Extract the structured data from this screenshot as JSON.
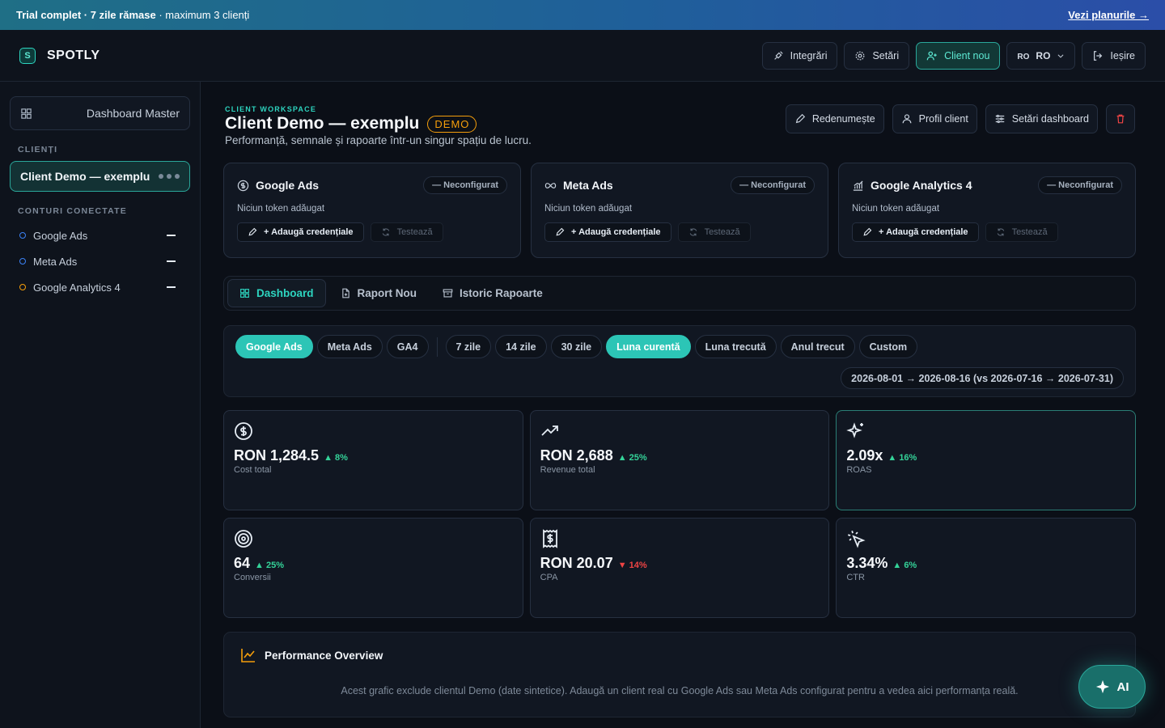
{
  "banner": {
    "text_bold": "Trial complet · 7 zile rămase",
    "text_rest": " · maximum 3 clienți",
    "link": "Vezi planurile →"
  },
  "header": {
    "logo_mark": "S",
    "app_name": "SPOTLY",
    "integrations": "Integrări",
    "settings": "Setări",
    "new_client": "Client nou",
    "lang_small": "RO",
    "lang": "RO",
    "logout": "Ieșire"
  },
  "sidebar": {
    "dashboard_master": "Dashboard Master",
    "clients_label": "CLIENȚI",
    "client": "Client Demo — exemplu",
    "accounts_label": "CONTURI CONECTATE",
    "accounts": [
      {
        "name": "Google Ads",
        "color": "#3b82f6"
      },
      {
        "name": "Meta Ads",
        "color": "#3b82f6"
      },
      {
        "name": "Google Analytics 4",
        "color": "#f59e0b"
      }
    ]
  },
  "workspace": {
    "label": "CLIENT WORKSPACE",
    "title": "Client Demo — exemplu",
    "badge": "DEMO",
    "subtitle": "Performanță, semnale și rapoarte într-un singur spațiu de lucru.",
    "rename": "Redenumește",
    "profile": "Profil client",
    "dash_settings": "Setări dashboard"
  },
  "integrations": [
    {
      "name": "Google Ads",
      "status": "— Neconfigurat",
      "note": "Niciun token adăugat",
      "add": "+ Adaugă credențiale",
      "test": "Testează",
      "icon": "dollar-icon"
    },
    {
      "name": "Meta Ads",
      "status": "— Neconfigurat",
      "note": "Niciun token adăugat",
      "add": "+ Adaugă credențiale",
      "test": "Testează",
      "icon": "infinity-icon"
    },
    {
      "name": "Google Analytics 4",
      "status": "— Neconfigurat",
      "note": "Niciun token adăugat",
      "add": "+ Adaugă credențiale",
      "test": "Testează",
      "icon": "analytics-icon"
    }
  ],
  "tabs": [
    "Dashboard",
    "Raport Nou",
    "Istoric Rapoarte"
  ],
  "filters": {
    "sources": [
      "Google Ads",
      "Meta Ads",
      "GA4"
    ],
    "periods": [
      "7 zile",
      "14 zile",
      "30 zile",
      "Luna curentă",
      "Luna trecută",
      "Anul trecut",
      "Custom"
    ],
    "active_source": "Google Ads",
    "active_period": "Luna curentă",
    "range": "2026-08-01 → 2026-08-16 (vs 2026-07-16 → 2026-07-31)"
  },
  "kpis": [
    {
      "value": "RON 1,284.5",
      "delta": "▲ 8%",
      "dir": "up",
      "label": "Cost total",
      "icon": "dollar-circle-icon"
    },
    {
      "value": "RON 2,688",
      "delta": "▲ 25%",
      "dir": "up",
      "label": "Revenue total",
      "icon": "trending-up-icon"
    },
    {
      "value": "2.09x",
      "delta": "▲ 16%",
      "dir": "up",
      "label": "ROAS",
      "icon": "sparkles-icon"
    },
    {
      "value": "64",
      "delta": "▲ 25%",
      "dir": "up",
      "label": "Conversii",
      "icon": "target-icon"
    },
    {
      "value": "RON 20.07",
      "delta": "▼ 14%",
      "dir": "down",
      "label": "CPA",
      "icon": "receipt-icon"
    },
    {
      "value": "3.34%",
      "delta": "▲ 6%",
      "dir": "up",
      "label": "CTR",
      "icon": "cursor-click-icon"
    }
  ],
  "performance": {
    "title": "Performance Overview",
    "note": "Acest grafic exclude clientul Demo (date sintetice). Adaugă un client real cu Google Ads sau Meta Ads configurat pentru a vedea aici performanța reală."
  },
  "ai": {
    "label": "AI"
  },
  "colors": {
    "accent": "#2dd4bf",
    "warning": "#f59e0b",
    "up": "#34d399",
    "down": "#ef4444"
  }
}
